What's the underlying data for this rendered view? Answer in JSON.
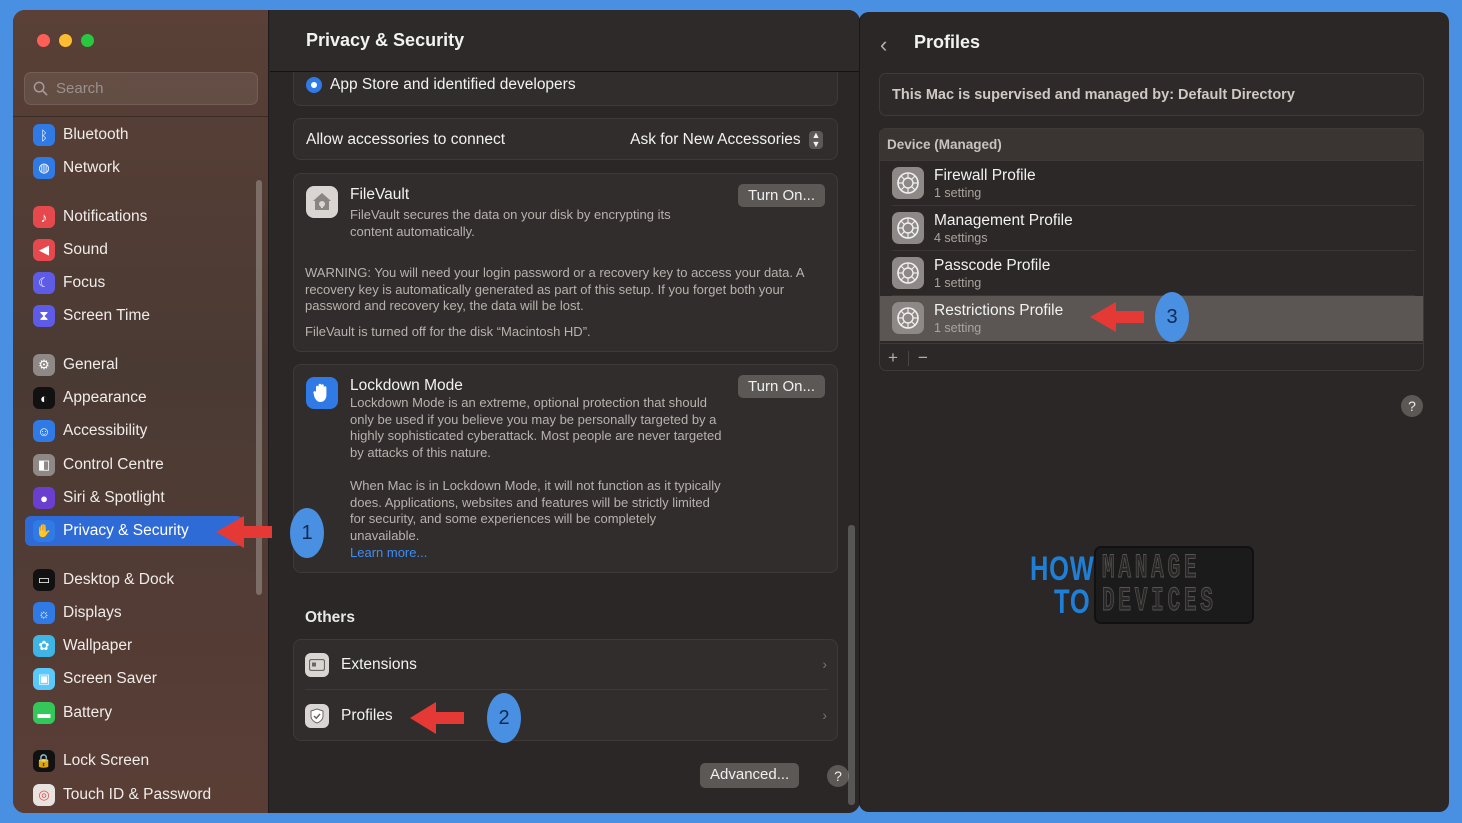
{
  "sidebar": {
    "search_placeholder": "Search",
    "items": [
      {
        "label": "Bluetooth",
        "icon": "bluetooth-icon",
        "color": "#2f7ae5"
      },
      {
        "label": "Network",
        "icon": "globe-icon",
        "color": "#2f7ae5"
      },
      {
        "label": "Notifications",
        "icon": "bell-icon",
        "color": "#e5484d"
      },
      {
        "label": "Sound",
        "icon": "speaker-icon",
        "color": "#e5484d"
      },
      {
        "label": "Focus",
        "icon": "moon-icon",
        "color": "#5e5ce6"
      },
      {
        "label": "Screen Time",
        "icon": "hourglass-icon",
        "color": "#5e5ce6"
      },
      {
        "label": "General",
        "icon": "gear-icon",
        "color": "#8e8986"
      },
      {
        "label": "Appearance",
        "icon": "appearance-icon",
        "color": "#111111"
      },
      {
        "label": "Accessibility",
        "icon": "accessibility-icon",
        "color": "#2f7ae5"
      },
      {
        "label": "Control Centre",
        "icon": "toggles-icon",
        "color": "#8e8986"
      },
      {
        "label": "Siri & Spotlight",
        "icon": "siri-icon",
        "color": "#6a3fd0"
      },
      {
        "label": "Privacy & Security",
        "icon": "hand-icon",
        "color": "#2f7ae5"
      },
      {
        "label": "Desktop & Dock",
        "icon": "dock-icon",
        "color": "#111111"
      },
      {
        "label": "Displays",
        "icon": "sun-icon",
        "color": "#2f7ae5"
      },
      {
        "label": "Wallpaper",
        "icon": "flower-icon",
        "color": "#3fb5e5"
      },
      {
        "label": "Screen Saver",
        "icon": "screensaver-icon",
        "color": "#5ac8fa"
      },
      {
        "label": "Battery",
        "icon": "battery-icon",
        "color": "#34c759"
      },
      {
        "label": "Lock Screen",
        "icon": "lock-icon",
        "color": "#111111"
      },
      {
        "label": "Touch ID & Password",
        "icon": "fingerprint-icon",
        "color": "#e8e3e0"
      }
    ]
  },
  "content": {
    "title": "Privacy & Security",
    "app_store_option": "App Store and identified developers",
    "accessories_label": "Allow accessories to connect",
    "accessories_value": "Ask for New Accessories",
    "filevault": {
      "title": "FileVault",
      "description": "FileVault secures the data on your disk by encrypting its content automatically.",
      "button": "Turn On...",
      "warning": "WARNING: You will need your login password or a recovery key to access your data. A recovery key is automatically generated as part of this setup. If you forget both your password and recovery key, the data will be lost.",
      "status": "FileVault is turned off for the disk “Macintosh HD”."
    },
    "lockdown": {
      "title": "Lockdown Mode",
      "description": "Lockdown Mode is an extreme, optional protection that should only be used if you believe you may be personally targeted by a highly sophisticated cyberattack. Most people are never targeted by attacks of this nature.",
      "description2": "When Mac is in Lockdown Mode, it will not function as it typically does. Applications, websites and features will be strictly limited for security, and some experiences will be completely unavailable.",
      "learn_more": "Learn more...",
      "button": "Turn On..."
    },
    "others_heading": "Others",
    "others": [
      {
        "label": "Extensions",
        "icon": "extensions-icon"
      },
      {
        "label": "Profiles",
        "icon": "profiles-icon"
      }
    ],
    "advanced_button": "Advanced...",
    "help": "?"
  },
  "profiles_pane": {
    "title": "Profiles",
    "supervised_text": "This Mac is supervised and managed by: Default Directory",
    "section_header": "Device (Managed)",
    "profiles": [
      {
        "name": "Firewall Profile",
        "sub": "1 setting"
      },
      {
        "name": "Management Profile",
        "sub": "4 settings"
      },
      {
        "name": "Passcode Profile",
        "sub": "1 setting"
      },
      {
        "name": "Restrictions Profile",
        "sub": "1 setting"
      }
    ],
    "add": "+",
    "remove": "−",
    "help": "?"
  },
  "annotations": {
    "badge1": "1",
    "badge2": "2",
    "badge3": "3",
    "arrow_color": "#e53935"
  },
  "logo": {
    "how": "HOW",
    "to": "TO",
    "manage": "MANAGE",
    "devices": "DEVICES"
  }
}
